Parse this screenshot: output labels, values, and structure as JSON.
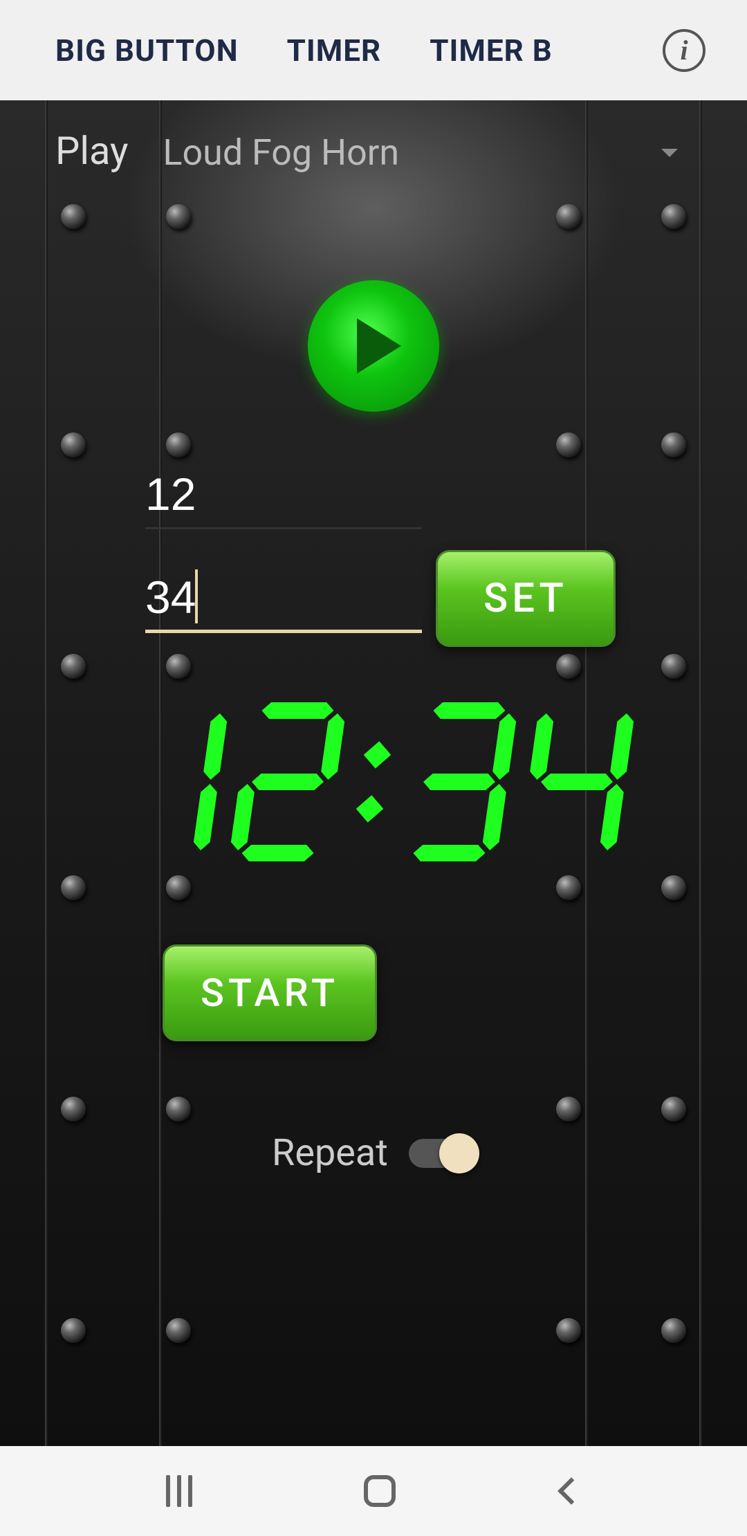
{
  "tabs": {
    "big_button": "BIG BUTTON",
    "timer": "TIMER",
    "timer_b": "TIMER B"
  },
  "sound": {
    "play_label": "Play",
    "selected": "Loud Fog Horn"
  },
  "inputs": {
    "minutes": "12",
    "seconds": "34"
  },
  "buttons": {
    "set": "SET",
    "start": "START"
  },
  "display": {
    "time": "12:34"
  },
  "repeat": {
    "label": "Repeat",
    "on": true
  }
}
